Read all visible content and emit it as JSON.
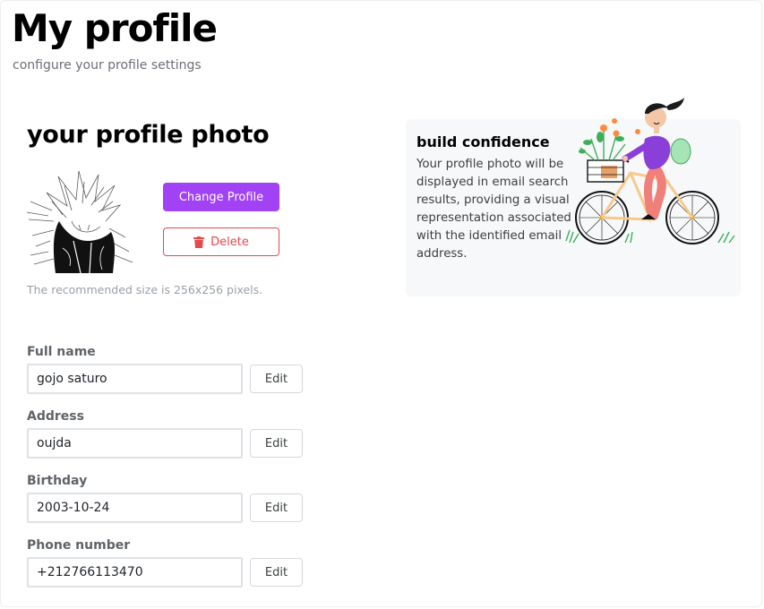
{
  "header": {
    "title": "My profile",
    "subtitle": "configure your profile settings"
  },
  "photo_section": {
    "title": "your profile photo",
    "change_button": "Change Profile",
    "delete_button": "Delete",
    "hint": "The recommended size is 256x256 pixels."
  },
  "info_card": {
    "title": "build confidence",
    "text": "Your profile photo will be displayed in email search results, providing a visual representation associated with the identified email address."
  },
  "fields": [
    {
      "label": "Full name",
      "value": "gojo saturo",
      "edit_label": "Edit"
    },
    {
      "label": "Address",
      "value": "oujda",
      "edit_label": "Edit"
    },
    {
      "label": "Birthday",
      "value": "2003-10-24",
      "edit_label": "Edit"
    },
    {
      "label": "Phone number",
      "value": "+212766113470",
      "edit_label": "Edit"
    }
  ],
  "colors": {
    "accent": "#a142f4",
    "danger": "#e5484d",
    "card_bg": "#f7f8fa"
  },
  "icons": {
    "delete": "trash-icon"
  }
}
